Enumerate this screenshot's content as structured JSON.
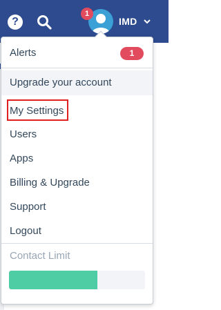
{
  "topbar": {
    "help_icon": "question-circle-icon",
    "help_glyph": "?",
    "search_icon": "search-icon",
    "notification_count": "1",
    "user_initials": "IMD",
    "chevron_icon": "chevron-down-icon",
    "bar_color": "#2d4b8e"
  },
  "menu": {
    "alerts": {
      "label": "Alerts",
      "count": "1"
    },
    "upgrade": {
      "label": "Upgrade your account"
    },
    "my_settings": {
      "label": "My Settings"
    },
    "users": {
      "label": "Users"
    },
    "apps": {
      "label": "Apps"
    },
    "billing": {
      "label": "Billing & Upgrade"
    },
    "support": {
      "label": "Support"
    },
    "logout": {
      "label": "Logout"
    }
  },
  "contact_limit": {
    "label": "Contact Limit",
    "fill_fraction": 0.65,
    "fill_color": "#4ecca3"
  },
  "colors": {
    "badge": "#e24a5e",
    "highlight_box": "#e02020"
  }
}
